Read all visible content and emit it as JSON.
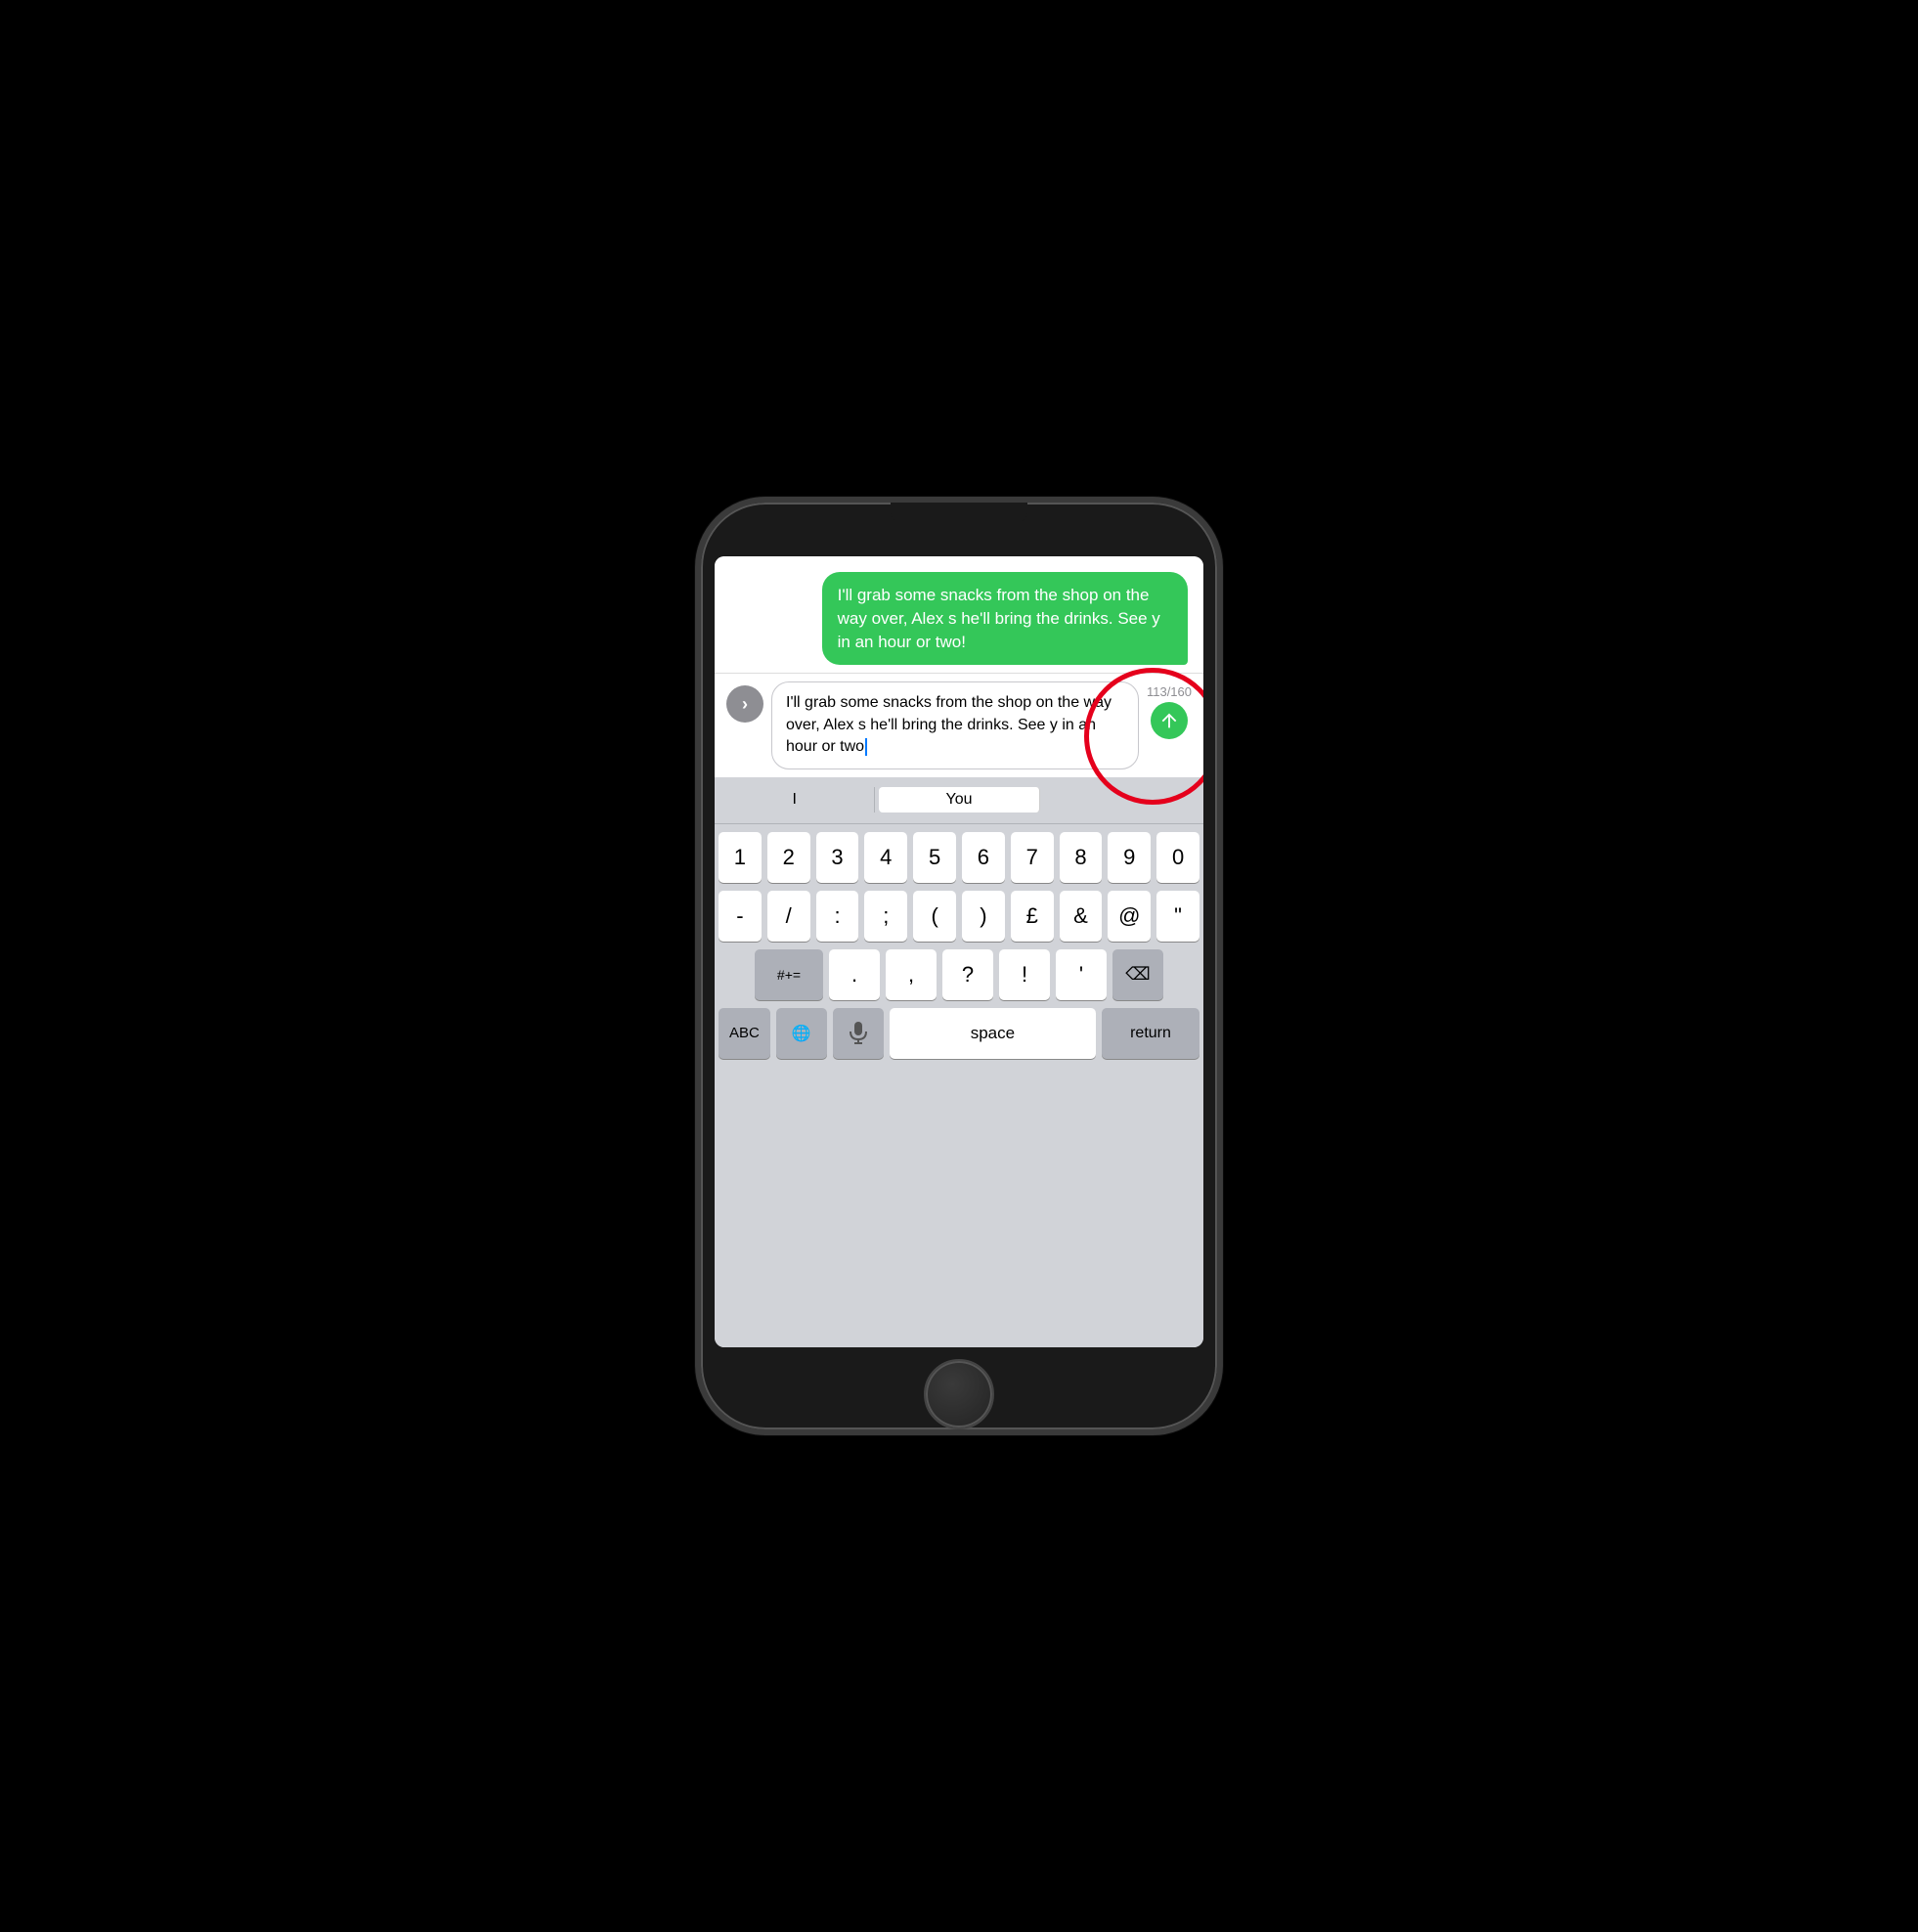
{
  "phone": {
    "screen": {
      "messages": {
        "green_bubble_text": "I'll grab some snacks from the shop on the way over, Alex s he'll bring the drinks. See y in an hour or two!"
      },
      "input": {
        "expand_icon": "›",
        "char_count": "113/160",
        "send_icon": "↑"
      },
      "predictive": {
        "items": [
          "I",
          "You",
          ""
        ]
      },
      "keyboard": {
        "rows": [
          [
            "1",
            "2",
            "3",
            "4",
            "5",
            "6",
            "7",
            "8",
            "9",
            "0"
          ],
          [
            "-",
            "/",
            ":",
            ";",
            "(",
            ")",
            "£",
            "&",
            "@",
            "\""
          ],
          [
            "#+=",
            ".",
            ",",
            "?",
            "!",
            "'",
            "⌫"
          ],
          [
            "ABC",
            "🌐",
            "🎤",
            "space",
            "return"
          ]
        ]
      }
    }
  }
}
